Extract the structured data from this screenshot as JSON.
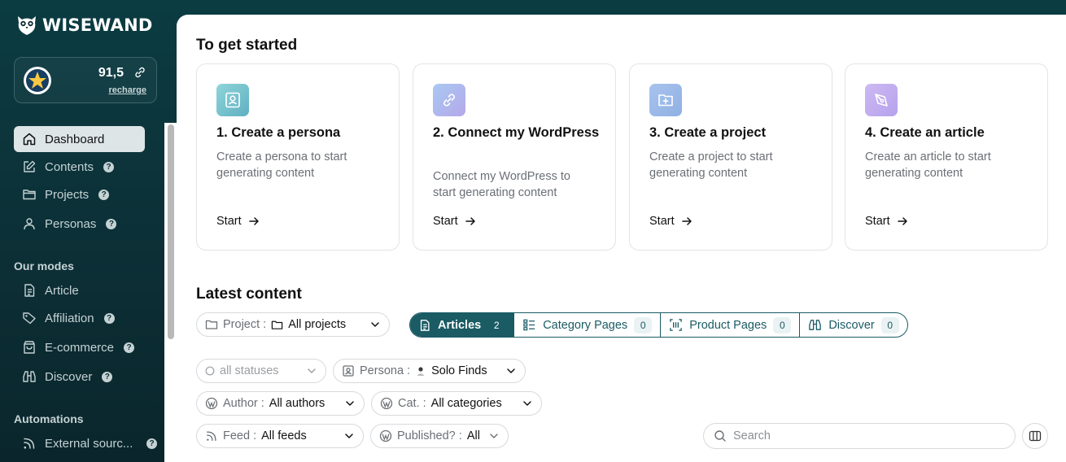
{
  "app": {
    "logo_text": "WISEWAND"
  },
  "credits": {
    "value": "91,5",
    "recharge_label": "recharge"
  },
  "nav": {
    "items": [
      {
        "label": "Dashboard",
        "icon": "home-icon",
        "active": true,
        "help": ""
      },
      {
        "label": "Contents",
        "icon": "edit-icon",
        "help": "?"
      },
      {
        "label": "Projects",
        "icon": "folder-icon",
        "help": "?"
      },
      {
        "label": "Personas",
        "icon": "user-icon",
        "help": "?"
      }
    ],
    "modes_title": "Our modes",
    "modes": [
      {
        "label": "Article",
        "icon": "document-icon",
        "help": ""
      },
      {
        "label": "Affiliation",
        "icon": "tag-icon",
        "help": "?"
      },
      {
        "label": "E-commerce",
        "icon": "bag-icon",
        "help": "?"
      },
      {
        "label": "Discover",
        "icon": "binoculars-icon",
        "help": "?"
      }
    ],
    "automations_title": "Automations",
    "automations": [
      {
        "label": "External sourc...",
        "icon": "rss-icon",
        "help": "?"
      }
    ]
  },
  "main": {
    "getting_started_title": "To get started",
    "cards": [
      {
        "title": "1. Create a persona",
        "desc": "Create a persona to start generating content",
        "start": "Start",
        "icon": "persona-icon",
        "color": "#7cc7cf"
      },
      {
        "title": "2. Connect my WordPress",
        "desc": "Connect my WordPress to start generating content",
        "start": "Start",
        "icon": "link-icon",
        "color": "#8fb8e8"
      },
      {
        "title": "3. Create a project",
        "desc": "Create a project to start generating content",
        "start": "Start",
        "icon": "folder-plus-icon",
        "color": "#9dbbe6"
      },
      {
        "title": "4. Create an article",
        "desc": "Create an article to start generating content",
        "start": "Start",
        "icon": "pen-icon",
        "color": "#c6b3ee"
      }
    ],
    "latest_title": "Latest content",
    "filters": {
      "project_label": "Project :",
      "project_value": "All projects",
      "status_placeholder": "all statuses",
      "persona_label": "Persona :",
      "persona_value": "Solo Finds",
      "author_label": "Author :",
      "author_value": "All authors",
      "cat_label": "Cat. :",
      "cat_value": "All categories",
      "feed_label": "Feed :",
      "feed_value": "All feeds",
      "published_label": "Published? :",
      "published_value": "All"
    },
    "tabs": [
      {
        "label": "Articles",
        "count": "2",
        "icon": "document-icon",
        "active": true
      },
      {
        "label": "Category Pages",
        "count": "0",
        "icon": "list-icon"
      },
      {
        "label": "Product Pages",
        "count": "0",
        "icon": "barcode-icon"
      },
      {
        "label": "Discover",
        "count": "0",
        "icon": "binoculars-icon"
      }
    ],
    "search_placeholder": "Search"
  },
  "colors": {
    "sidebar_bg": "#0c2e35",
    "accent": "#1a5b64"
  }
}
